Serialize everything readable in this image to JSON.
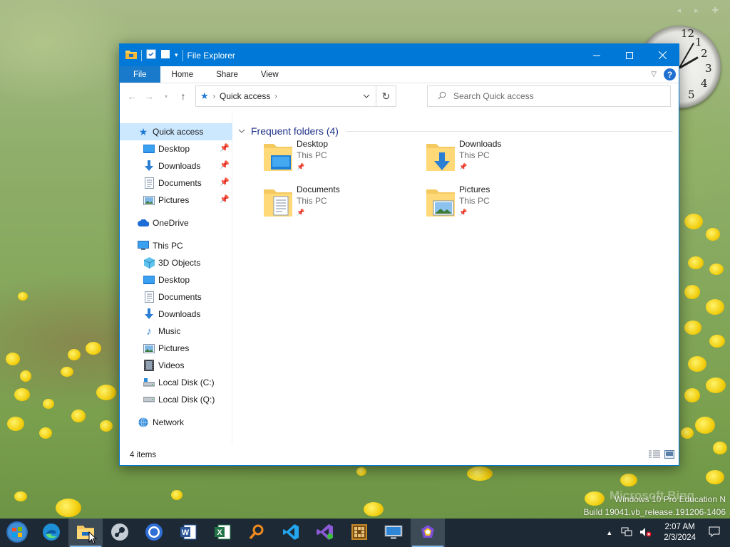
{
  "window": {
    "title": "File Explorer",
    "ribbon_tabs": [
      "File",
      "Home",
      "Share",
      "View"
    ]
  },
  "address": {
    "location": "Quick access",
    "search_placeholder": "Search Quick access"
  },
  "navigation": {
    "quick_access": "Quick access",
    "pinned": [
      {
        "label": "Desktop",
        "icon": "desktop-icon"
      },
      {
        "label": "Downloads",
        "icon": "downloads-icon"
      },
      {
        "label": "Documents",
        "icon": "documents-icon"
      },
      {
        "label": "Pictures",
        "icon": "pictures-icon"
      }
    ],
    "onedrive": "OneDrive",
    "this_pc": "This PC",
    "this_pc_items": [
      {
        "label": "3D Objects",
        "icon": "3d-objects-icon"
      },
      {
        "label": "Desktop",
        "icon": "desktop-icon"
      },
      {
        "label": "Documents",
        "icon": "documents-icon"
      },
      {
        "label": "Downloads",
        "icon": "downloads-icon"
      },
      {
        "label": "Music",
        "icon": "music-icon"
      },
      {
        "label": "Pictures",
        "icon": "pictures-icon"
      },
      {
        "label": "Videos",
        "icon": "videos-icon"
      },
      {
        "label": "Local Disk (C:)",
        "icon": "drive-icon"
      },
      {
        "label": "Local Disk (Q:)",
        "icon": "drive-icon"
      }
    ],
    "network": "Network"
  },
  "content": {
    "section_title": "Frequent folders (4)",
    "folders": [
      {
        "name": "Desktop",
        "location": "This PC",
        "icon": "desktop-folder-icon"
      },
      {
        "name": "Downloads",
        "location": "This PC",
        "icon": "downloads-folder-icon"
      },
      {
        "name": "Documents",
        "location": "This PC",
        "icon": "documents-folder-icon"
      },
      {
        "name": "Pictures",
        "location": "This PC",
        "icon": "pictures-folder-icon"
      }
    ]
  },
  "status": {
    "item_count": "4 items"
  },
  "desktop": {
    "watermark_line1": "Windows 10 Pro Education N",
    "watermark_line2": "Build 19041.vb_release.191206-1406",
    "bing_text": "Microsoft Bing"
  },
  "taskbar": {
    "apps": [
      "start-icon",
      "edge-icon",
      "file-explorer-icon",
      "steam-icon",
      "chrome-icon",
      "word-icon",
      "excel-icon",
      "search-tool-icon",
      "vscode-icon",
      "visual-studio-icon",
      "app-grid-icon",
      "remote-desktop-icon",
      "paint-icon"
    ],
    "time": "2:07 AM",
    "date": "2/3/2024"
  },
  "colors": {
    "titlebar": "#0078d7",
    "selection": "#cce8ff",
    "taskbar": "#1d2a35",
    "section_title": "#1e3287"
  }
}
